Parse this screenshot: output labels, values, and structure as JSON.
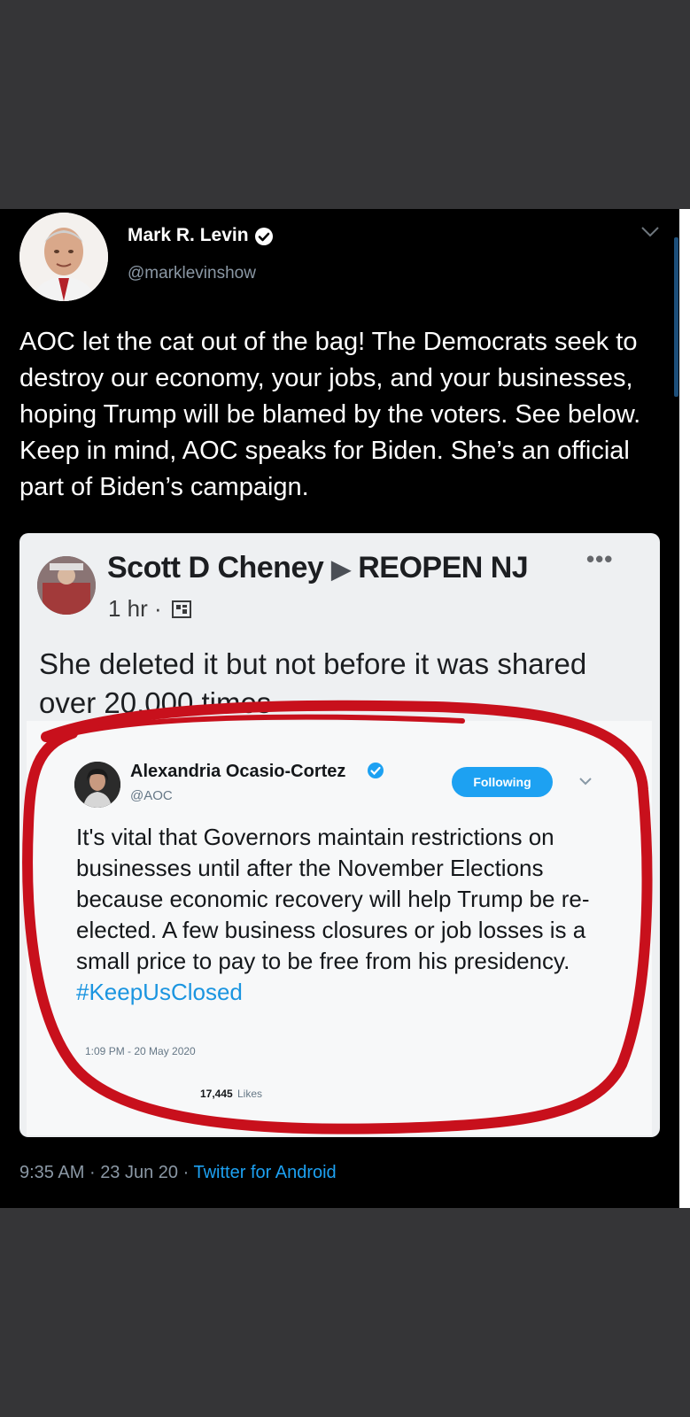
{
  "tweet": {
    "author_name": "Mark R. Levin",
    "author_handle": "@marklevinshow",
    "text": "AOC let the cat out of the bag!  The Democrats seek to destroy our economy, your jobs, and your businesses, hoping Trump will be blamed by the voters.  See below. Keep in mind, AOC speaks for Biden. She’s an official part of Biden’s campaign.",
    "time": "9:35 AM",
    "separator": "·",
    "date": "23 Jun 20",
    "source": "Twitter for Android"
  },
  "embedded_post": {
    "author_name": "Scott D Cheney",
    "arrow": "▶",
    "group_name": "REOPEN NJ",
    "more": "•••",
    "time": "1 hr ·",
    "text": "She deleted it but not before it was shared over 20,000 times"
  },
  "quoted_tweet": {
    "author_name": "Alexandria Ocasio-Cortez",
    "author_handle": "@AOC",
    "follow_label": "Following",
    "text": "It's vital that Governors maintain restrictions on businesses until after the November Elections because economic recovery will help Trump be re-elected. A few business closures or job losses is a small price to pay to be free from his presidency. ",
    "hashtag": "#KeepUsClosed",
    "timestamp": "1:09 PM - 20 May 2020",
    "likes_count": "17,445",
    "likes_label": "Likes"
  },
  "colors": {
    "tweet_background": "#000000",
    "page_background": "#353537",
    "link_blue": "#1da1f2",
    "annotation_red": "#c8101c"
  },
  "icons": {
    "verified": "verified-badge-icon",
    "chevron": "chevron-down-icon",
    "globe": "globe-icon"
  }
}
